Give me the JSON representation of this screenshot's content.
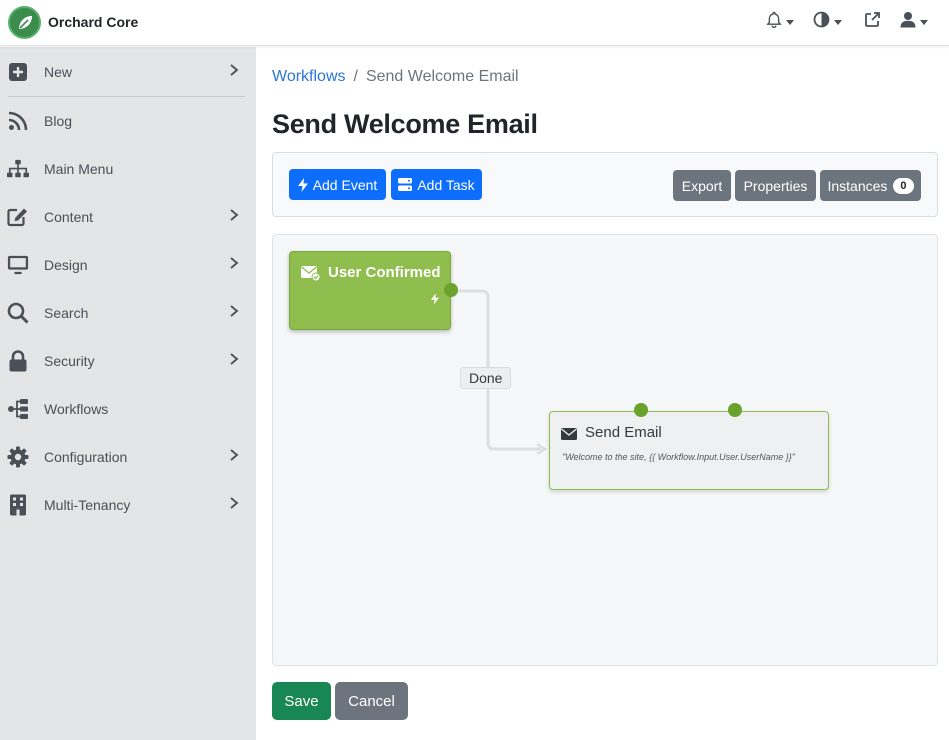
{
  "app": {
    "brand": "Orchard Core"
  },
  "sidebar": {
    "items": [
      {
        "label": "New",
        "icon": "plus-square-icon",
        "chevron": true
      },
      {
        "label": "Blog",
        "icon": "rss-icon",
        "chevron": false
      },
      {
        "label": "Main Menu",
        "icon": "sitemap-icon",
        "chevron": false
      },
      {
        "label": "Content",
        "icon": "edit-icon",
        "chevron": true
      },
      {
        "label": "Design",
        "icon": "monitor-icon",
        "chevron": true
      },
      {
        "label": "Search",
        "icon": "search-icon",
        "chevron": true
      },
      {
        "label": "Security",
        "icon": "lock-icon",
        "chevron": true
      },
      {
        "label": "Workflows",
        "icon": "workflow-icon",
        "chevron": false
      },
      {
        "label": "Configuration",
        "icon": "gear-icon",
        "chevron": true
      },
      {
        "label": "Multi-Tenancy",
        "icon": "building-icon",
        "chevron": true
      }
    ]
  },
  "breadcrumb": {
    "parent": "Workflows",
    "separator": "/",
    "current": "Send Welcome Email"
  },
  "page": {
    "title": "Send Welcome Email"
  },
  "toolbar": {
    "add_event": "Add Event",
    "add_task": "Add Task",
    "export": "Export",
    "properties": "Properties",
    "instances": "Instances",
    "instances_count": "0"
  },
  "workflow": {
    "event_title": "User Confirmed",
    "task_title": "Send Email",
    "task_description": "\"Welcome to the site, {{ Workflow.Input.User.UserName }}\"",
    "connection_label": "Done"
  },
  "actions": {
    "save": "Save",
    "cancel": "Cancel"
  },
  "colors": {
    "primary": "#0d6efd",
    "secondary": "#6c757d",
    "success": "#198754",
    "event": "#8fbe4f",
    "endpoint": "#6aa22c",
    "link": "#2c76d6"
  }
}
